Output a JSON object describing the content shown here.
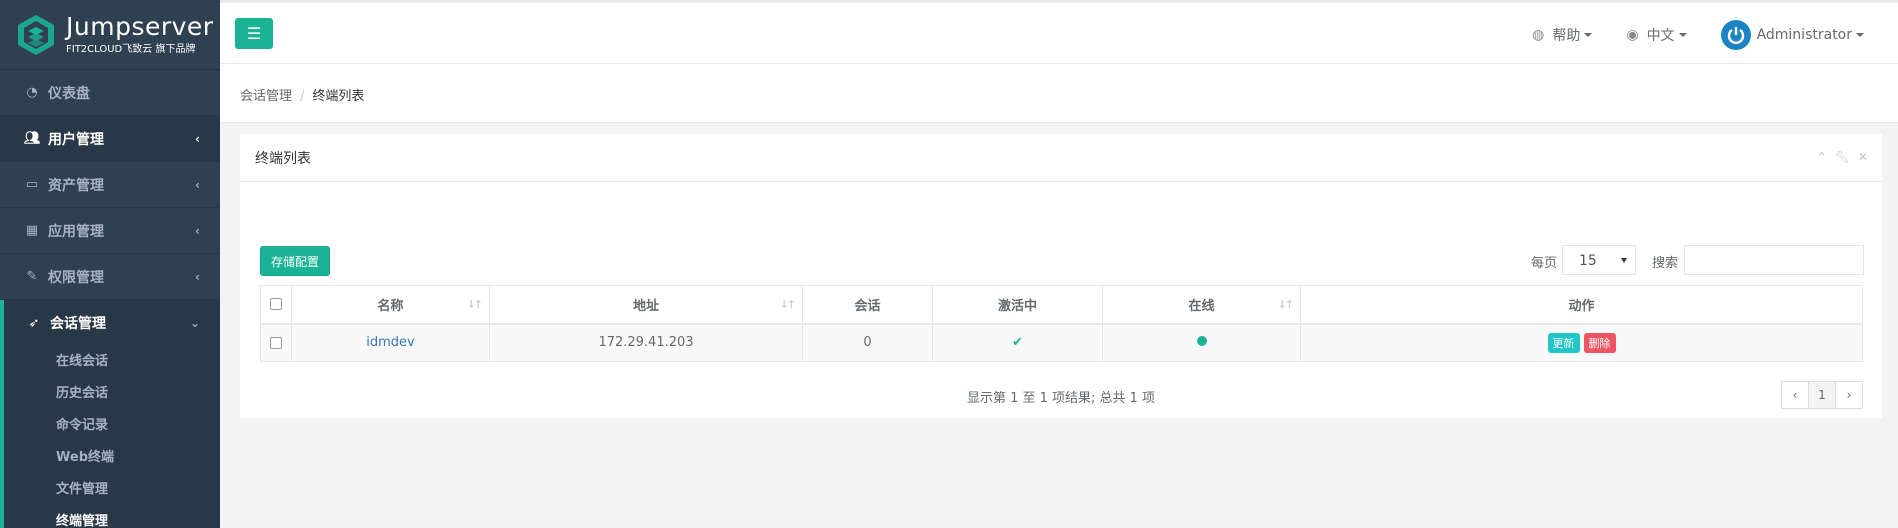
{
  "brand": {
    "name": "Jumpserver",
    "subtitle": "FIT2CLOUD飞致云 旗下品牌"
  },
  "sidebar": {
    "items": [
      {
        "label": "仪表盘",
        "icon": "dashboard-icon"
      },
      {
        "label": "用户管理",
        "icon": "users-icon"
      },
      {
        "label": "资产管理",
        "icon": "inbox-icon"
      },
      {
        "label": "应用管理",
        "icon": "grid-icon"
      },
      {
        "label": "权限管理",
        "icon": "edit-icon"
      }
    ],
    "active_group": {
      "label": "会话管理",
      "icon": "rocket-icon",
      "children": [
        "在线会话",
        "历史会话",
        "命令记录",
        "Web终端",
        "文件管理",
        "终端管理"
      ]
    }
  },
  "topbar": {
    "help": "帮助",
    "language": "中文",
    "user": "Administrator"
  },
  "breadcrumb": {
    "parent": "会话管理",
    "current": "终端列表"
  },
  "panel": {
    "title": "终端列表",
    "storage_button": "存储配置",
    "page_size_label": "每页",
    "page_size_value": "15",
    "search_label": "搜索",
    "search_value": ""
  },
  "table": {
    "columns": [
      "名称",
      "地址",
      "会话",
      "激活中",
      "在线",
      "动作"
    ],
    "rows": [
      {
        "name": "idmdev",
        "address": "172.29.41.203",
        "sessions": "0",
        "active": "✔",
        "online": "●",
        "actions": [
          "更新",
          "删除"
        ]
      }
    ]
  },
  "footer": {
    "info": "显示第 1 至 1 项结果; 总共 1 项",
    "prev": "‹",
    "page": "1",
    "next": "›"
  },
  "colors": {
    "sidebar_bg": "#2f4050",
    "accent": "#1ab394",
    "info": "#23c6c8",
    "danger": "#ed5565"
  }
}
